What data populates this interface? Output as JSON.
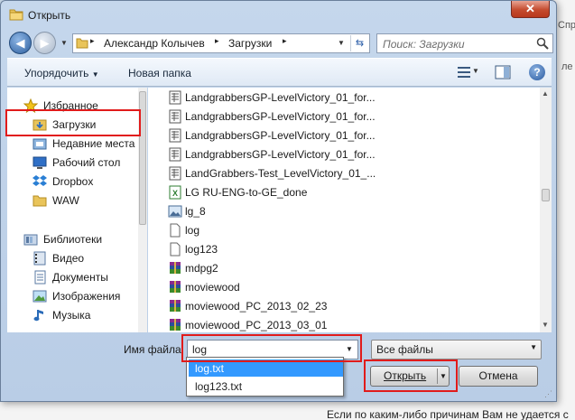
{
  "window": {
    "title": "Открыть",
    "close_glyph": "✕"
  },
  "address": {
    "segments": [
      "Александр Колычев",
      "Загрузки"
    ],
    "separator": "▸",
    "search_placeholder": "Поиск: Загрузки"
  },
  "toolbar": {
    "organize": "Упорядочить",
    "new_folder": "Новая папка"
  },
  "nav": {
    "favorites": "Избранное",
    "items": [
      {
        "label": "Загрузки",
        "icon": "downloads-folder-icon"
      },
      {
        "label": "Недавние места",
        "icon": "recent-places-icon"
      },
      {
        "label": "Рабочий стол",
        "icon": "desktop-icon"
      },
      {
        "label": "Dropbox",
        "icon": "dropbox-icon"
      },
      {
        "label": "WAW",
        "icon": "folder-icon"
      }
    ],
    "libraries": "Библиотеки",
    "library_items": [
      {
        "label": "Видео",
        "icon": "video-library-icon"
      },
      {
        "label": "Документы",
        "icon": "documents-library-icon"
      },
      {
        "label": "Изображения",
        "icon": "images-library-icon"
      },
      {
        "label": "Музыка",
        "icon": "music-library-icon"
      }
    ]
  },
  "files": [
    {
      "name": "LandgrabbersGP-LevelVictory_01_for...",
      "icon": "spreadsheet-file-icon"
    },
    {
      "name": "LandgrabbersGP-LevelVictory_01_for...",
      "icon": "spreadsheet-file-icon"
    },
    {
      "name": "LandgrabbersGP-LevelVictory_01_for...",
      "icon": "spreadsheet-file-icon"
    },
    {
      "name": "LandgrabbersGP-LevelVictory_01_for...",
      "icon": "spreadsheet-file-icon"
    },
    {
      "name": "LandGrabbers-Test_LevelVictory_01_...",
      "icon": "spreadsheet-file-icon"
    },
    {
      "name": "LG RU-ENG-to-GE_done",
      "icon": "excel-file-icon"
    },
    {
      "name": "lg_8",
      "icon": "image-file-icon"
    },
    {
      "name": "log",
      "icon": "text-file-icon"
    },
    {
      "name": "log123",
      "icon": "text-file-icon"
    },
    {
      "name": "mdpg2",
      "icon": "archive-file-icon"
    },
    {
      "name": "moviewood",
      "icon": "archive-file-icon"
    },
    {
      "name": "moviewood_PC_2013_02_23",
      "icon": "archive-file-icon"
    },
    {
      "name": "moviewood_PC_2013_03_01",
      "icon": "archive-file-icon"
    }
  ],
  "bottom": {
    "filename_label": "Имя файла:",
    "filename_value": "log",
    "filetype_value": "Все файлы",
    "suggestions": [
      "log.txt",
      "log123.txt"
    ],
    "open_label": "Открыть",
    "cancel_label": "Отмена"
  },
  "background_page": {
    "bottom_text": "Если по каким-либо причинам Вам не удается с",
    "side_text_1": "Справка",
    "side_text_2": "ле"
  },
  "colors": {
    "highlight": "#e11b1b",
    "selection": "#3399ff"
  }
}
